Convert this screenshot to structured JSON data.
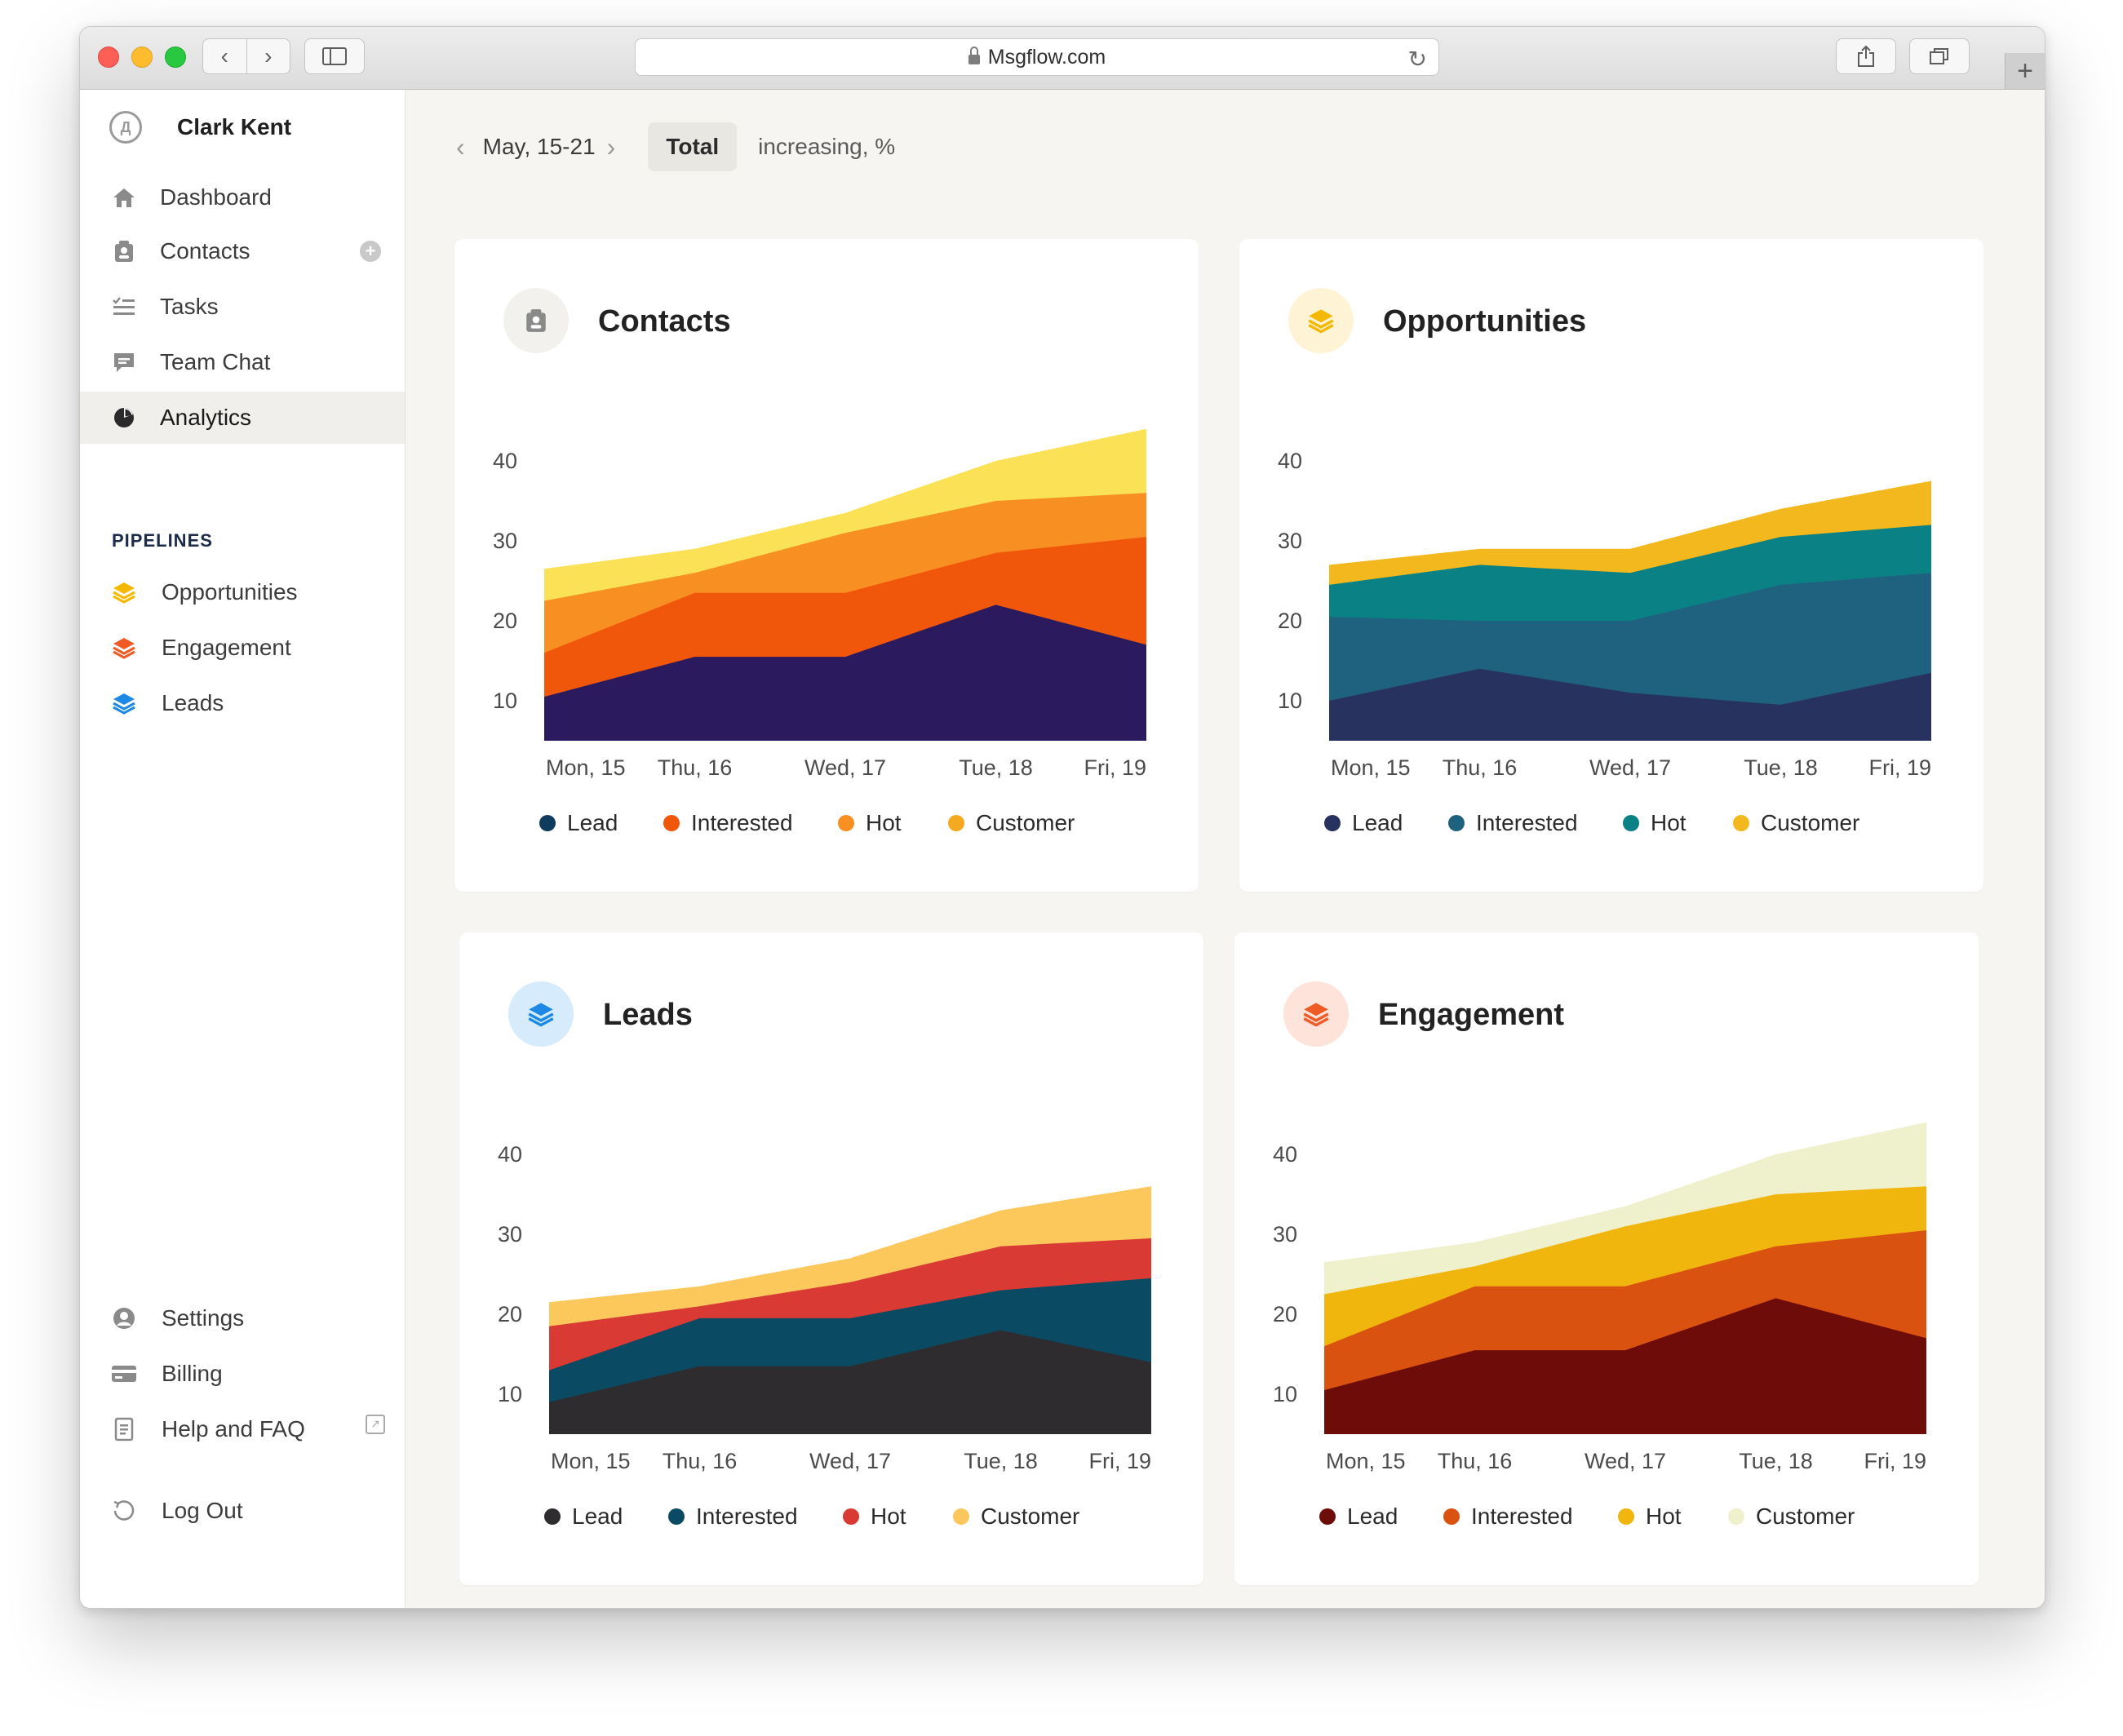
{
  "browser": {
    "url": "Msgflow.com",
    "back_icon": "chevron-left",
    "forward_icon": "chevron-right"
  },
  "sidebar": {
    "user_name": "Clark Kent",
    "nav": [
      {
        "label": "Dashboard",
        "icon": "home-icon"
      },
      {
        "label": "Contacts",
        "icon": "contacts-icon"
      },
      {
        "label": "Tasks",
        "icon": "tasks-icon"
      },
      {
        "label": "Team Chat",
        "icon": "chat-icon"
      },
      {
        "label": "Analytics",
        "icon": "pie-chart-icon",
        "active": true
      }
    ],
    "pipelines_title": "PIPELINES",
    "pipelines": [
      {
        "label": "Opportunities",
        "color": "#f5b800"
      },
      {
        "label": "Engagement",
        "color": "#f05a24"
      },
      {
        "label": "Leads",
        "color": "#1e88e5"
      }
    ],
    "bottom": [
      {
        "label": "Settings",
        "icon": "user-circle-icon"
      },
      {
        "label": "Billing",
        "icon": "credit-card-icon"
      },
      {
        "label": "Help and FAQ",
        "icon": "document-icon"
      },
      {
        "label": "Log Out",
        "icon": "logout-icon"
      }
    ]
  },
  "filters": {
    "date_range": "May, 15-21",
    "total_label": "Total",
    "metric_label": "increasing, %"
  },
  "chart_data": [
    {
      "title": "Contacts",
      "type": "area",
      "icon": "contacts-icon",
      "icon_bg": "#f3f1ed",
      "icon_color": "#8a8a8a",
      "categories": [
        "Mon, 15",
        "Thu, 16",
        "Wed, 17",
        "Tue, 18",
        "Fri, 19"
      ],
      "yticks": [
        10,
        20,
        30,
        40
      ],
      "ylim": [
        5,
        44
      ],
      "series": [
        {
          "name": "Lead",
          "color": "#2b1a5e",
          "values": [
            10.5,
            15.5,
            15.5,
            22,
            17
          ]
        },
        {
          "name": "Interested",
          "color": "#f0570a",
          "values": [
            16,
            23.5,
            23.5,
            28.5,
            30.5
          ]
        },
        {
          "name": "Hot",
          "color": "#f78f23",
          "values": [
            22.5,
            26,
            31,
            35,
            36
          ]
        },
        {
          "name": "Customer",
          "color": "#fae155",
          "values": [
            26.5,
            29,
            33.5,
            40,
            44
          ]
        }
      ],
      "legend_colors": [
        "#0f3b5f",
        "#f0570a",
        "#f78f23",
        "#f5a91f"
      ]
    },
    {
      "title": "Opportunities",
      "type": "area",
      "icon": "layers-icon",
      "icon_bg": "#fff3d6",
      "icon_color": "#f5b800",
      "categories": [
        "Mon, 15",
        "Thu, 16",
        "Wed, 17",
        "Tue, 18",
        "Fri, 19"
      ],
      "yticks": [
        10,
        20,
        30,
        40
      ],
      "ylim": [
        5,
        44
      ],
      "series": [
        {
          "name": "Lead",
          "color": "#27325e",
          "values": [
            10,
            14,
            11,
            9.5,
            13.5
          ]
        },
        {
          "name": "Interested",
          "color": "#1f627f",
          "values": [
            20.5,
            20,
            20,
            24.5,
            26
          ]
        },
        {
          "name": "Hot",
          "color": "#0a8285",
          "values": [
            24.5,
            27,
            26,
            30.5,
            32
          ]
        },
        {
          "name": "Customer",
          "color": "#f3b81d",
          "values": [
            27,
            29,
            29,
            34,
            37.5
          ]
        }
      ],
      "legend_colors": [
        "#27325e",
        "#1f627f",
        "#0a8285",
        "#f3b81d"
      ]
    },
    {
      "title": "Leads",
      "type": "area",
      "icon": "layers-icon",
      "icon_bg": "#d6ecfc",
      "icon_color": "#1e88e5",
      "categories": [
        "Mon, 15",
        "Thu, 16",
        "Wed, 17",
        "Tue, 18",
        "Fri, 19"
      ],
      "yticks": [
        10,
        20,
        30,
        40
      ],
      "ylim": [
        5,
        44
      ],
      "series": [
        {
          "name": "Lead",
          "color": "#2e2c2e",
          "values": [
            9,
            13.5,
            13.5,
            18,
            14
          ]
        },
        {
          "name": "Interested",
          "color": "#0a4b63",
          "values": [
            13,
            19.5,
            19.5,
            23,
            24.5
          ]
        },
        {
          "name": "Hot",
          "color": "#d93a34",
          "values": [
            18.5,
            21,
            24,
            28.5,
            29.5
          ]
        },
        {
          "name": "Customer",
          "color": "#fcc85c",
          "values": [
            21.5,
            23.5,
            27,
            33,
            36
          ]
        }
      ],
      "legend_colors": [
        "#2e2c2e",
        "#0a4b63",
        "#d93a34",
        "#fcc85c"
      ]
    },
    {
      "title": "Engagement",
      "type": "area",
      "icon": "layers-icon",
      "icon_bg": "#fde3da",
      "icon_color": "#f05a24",
      "categories": [
        "Mon, 15",
        "Thu, 16",
        "Wed, 17",
        "Tue, 18",
        "Fri, 19"
      ],
      "yticks": [
        10,
        20,
        30,
        40
      ],
      "ylim": [
        5,
        44
      ],
      "series": [
        {
          "name": "Lead",
          "color": "#6e0c0a",
          "values": [
            10.5,
            15.5,
            15.5,
            22,
            17
          ]
        },
        {
          "name": "Interested",
          "color": "#d9520f",
          "values": [
            16,
            23.5,
            23.5,
            28.5,
            30.5
          ]
        },
        {
          "name": "Hot",
          "color": "#f0b60d",
          "values": [
            22.5,
            26,
            31,
            35,
            36
          ]
        },
        {
          "name": "Customer",
          "color": "#eff0cc",
          "values": [
            26.5,
            29,
            33.5,
            40,
            44
          ]
        }
      ],
      "legend_colors": [
        "#6e0c0a",
        "#d9520f",
        "#f0b60d",
        "#eff0cc"
      ]
    }
  ]
}
